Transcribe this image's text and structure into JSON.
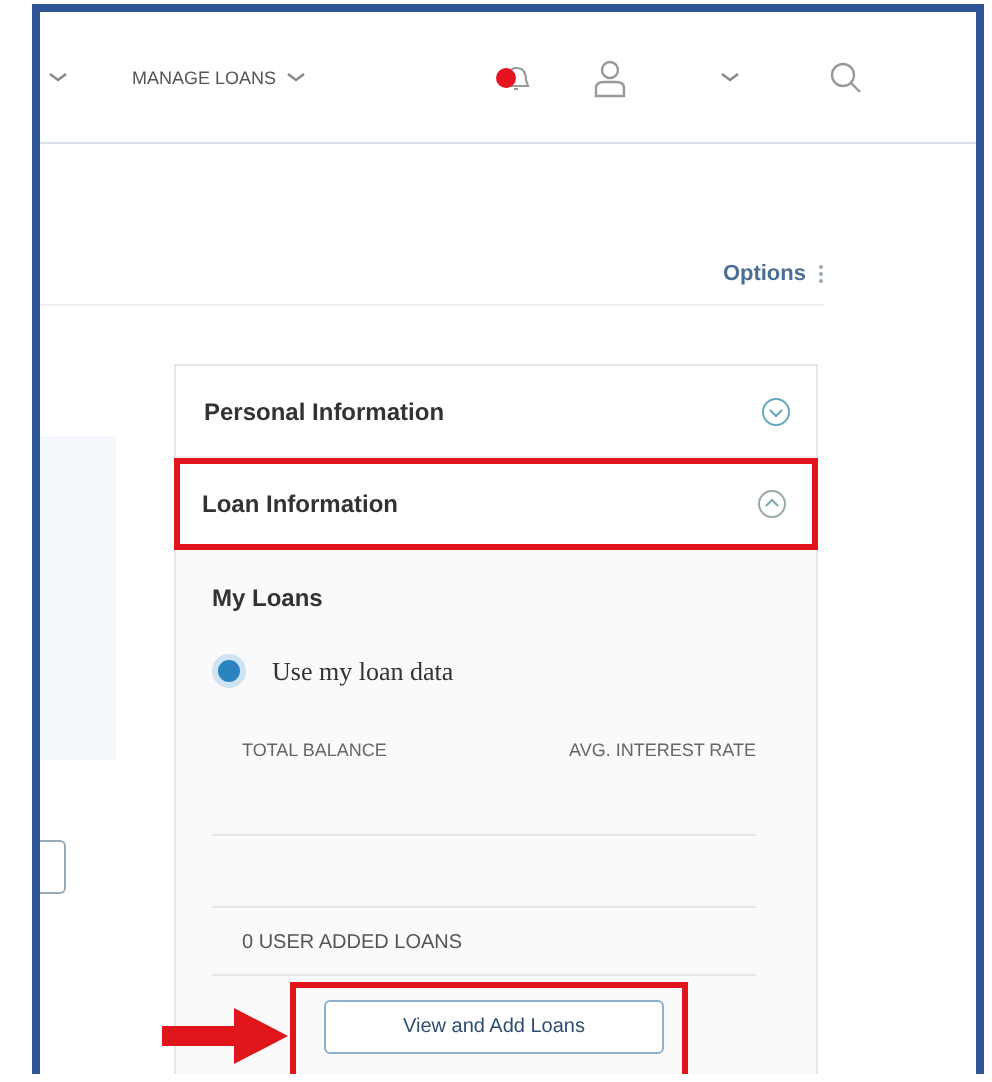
{
  "header": {
    "nav_items": [
      {
        "label": "MANAGE LOANS"
      }
    ]
  },
  "options_link": "Options",
  "panel": {
    "sections": [
      {
        "title": "Personal Information",
        "expanded": false,
        "highlighted": false
      },
      {
        "title": "Loan Information",
        "expanded": true,
        "highlighted": true
      }
    ],
    "my_loans": {
      "title": "My Loans",
      "radio": {
        "label": "Use my loan data",
        "selected": true
      },
      "columns": [
        "TOTAL BALANCE",
        "AVG. INTEREST RATE"
      ],
      "user_added_count": "0 USER ADDED LOANS",
      "button": {
        "label": "View and Add Loans",
        "highlighted": true
      }
    }
  }
}
